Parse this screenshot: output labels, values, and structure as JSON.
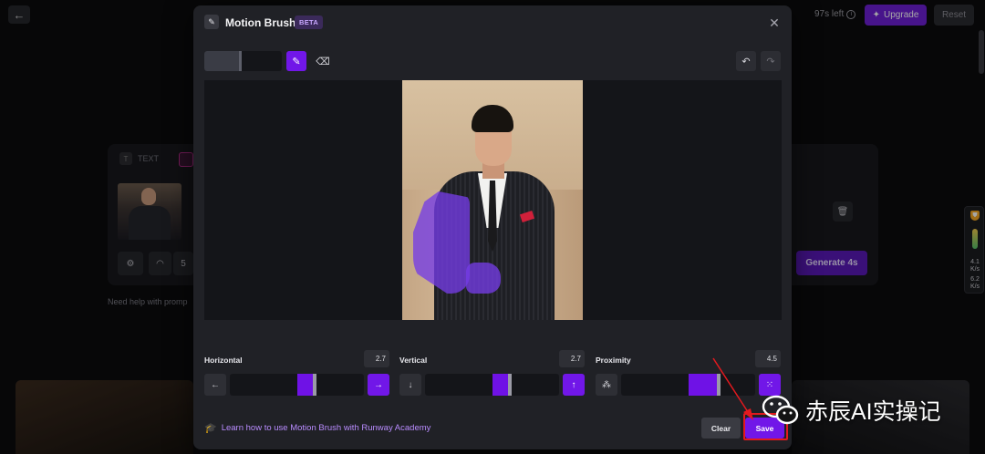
{
  "topbar": {
    "credits_text": "97s left",
    "upgrade_label": "Upgrade",
    "reset_label": "Reset"
  },
  "background": {
    "tab_text_label": "TEXT",
    "duration_value": "5",
    "generate_label": "Generate 4s",
    "help_text": "Need help with promp"
  },
  "side_widget": {
    "up_speed": "4.1",
    "up_unit": "K/s",
    "down_speed": "6.2",
    "down_unit": "K/s"
  },
  "modal": {
    "title": "Motion Brush",
    "badge": "BETA",
    "brush_size_level": 0.48,
    "sliders": [
      {
        "label": "Horizontal",
        "value": "2.7",
        "left_icon": "arrow-left-icon",
        "right_icon": "arrow-right-icon",
        "left_glyph": "←",
        "right_glyph": "→"
      },
      {
        "label": "Vertical",
        "value": "2.7",
        "left_icon": "arrow-down-icon",
        "right_icon": "arrow-up-icon",
        "left_glyph": "↓",
        "right_glyph": "↑"
      },
      {
        "label": "Proximity",
        "value": "4.5",
        "left_icon": "proximity-near-icon",
        "right_icon": "proximity-far-icon",
        "left_glyph": "⁂",
        "right_glyph": "⁙"
      }
    ],
    "academy_link": "Learn how to use Motion Brush with Runway Academy",
    "clear_label": "Clear",
    "save_label": "Save"
  },
  "watermark": {
    "text": "赤辰AI实操记"
  },
  "colors": {
    "accent": "#7117e8",
    "annotation_red": "#e3191e",
    "modal_bg": "#202126"
  }
}
